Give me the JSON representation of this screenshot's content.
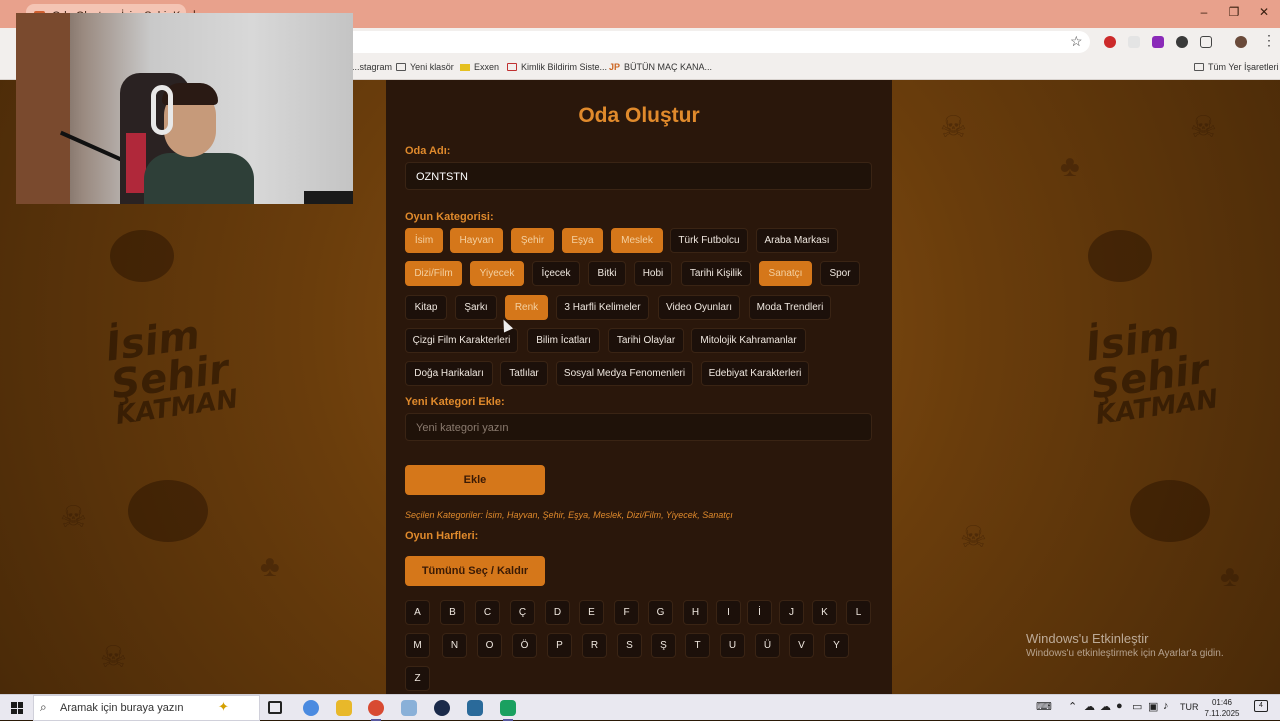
{
  "browser": {
    "tab_title": "Oda Oluştur - İsim Şehir Katman",
    "new_tab": "+",
    "bookmarks": [
      {
        "label": "...stagram",
        "icon": "instagram-icon"
      },
      {
        "label": "Yeni klasör",
        "icon": "folder-icon"
      },
      {
        "label": "Exxen",
        "icon": "exxen-icon"
      },
      {
        "label": "Kimlik Bildirim Siste...",
        "icon": "kimlik-icon"
      },
      {
        "label": "BÜTÜN MAÇ KANA...",
        "icon": "jp-icon"
      },
      {
        "label": "Tüm Yer İşaretleri",
        "icon": "folder-icon"
      }
    ],
    "bookmark_jp_prefix": "JP",
    "window_controls": {
      "minimize": "–",
      "restore": "❐",
      "close": "✕"
    }
  },
  "form": {
    "title": "Oda Oluştur",
    "room_name_label": "Oda Adı:",
    "room_name_value": "OZNTSTN",
    "category_label": "Oyun Kategorisi:",
    "categories": [
      {
        "label": "İsim",
        "selected": true
      },
      {
        "label": "Hayvan",
        "selected": true
      },
      {
        "label": "Şehir",
        "selected": true
      },
      {
        "label": "Eşya",
        "selected": true
      },
      {
        "label": "Meslek",
        "selected": true
      },
      {
        "label": "Türk Futbolcu",
        "selected": false
      },
      {
        "label": "Araba Markası",
        "selected": false
      },
      {
        "label": "Dizi/Film",
        "selected": true
      },
      {
        "label": "Yiyecek",
        "selected": true
      },
      {
        "label": "İçecek",
        "selected": false
      },
      {
        "label": "Bitki",
        "selected": false
      },
      {
        "label": "Hobi",
        "selected": false
      },
      {
        "label": "Tarihi Kişilik",
        "selected": false
      },
      {
        "label": "Sanatçı",
        "selected": true
      },
      {
        "label": "Spor",
        "selected": false
      },
      {
        "label": "Kitap",
        "selected": false
      },
      {
        "label": "Şarkı",
        "selected": false
      },
      {
        "label": "Renk",
        "selected": true
      },
      {
        "label": "3 Harfli Kelimeler",
        "selected": false
      },
      {
        "label": "Video Oyunları",
        "selected": false
      },
      {
        "label": "Moda Trendleri",
        "selected": false
      },
      {
        "label": "Çizgi Film Karakterleri",
        "selected": false
      },
      {
        "label": "Bilim İcatları",
        "selected": false
      },
      {
        "label": "Tarihi Olaylar",
        "selected": false
      },
      {
        "label": "Mitolojik Kahramanlar",
        "selected": false
      },
      {
        "label": "Doğa Harikaları",
        "selected": false
      },
      {
        "label": "Tatlılar",
        "selected": false
      },
      {
        "label": "Sosyal Medya Fenomenleri",
        "selected": false
      },
      {
        "label": "Edebiyat Karakterleri",
        "selected": false
      }
    ],
    "new_category_label": "Yeni Kategori Ekle:",
    "new_category_placeholder": "Yeni kategori yazın",
    "add_button": "Ekle",
    "selected_categories_text": "Seçilen Kategoriler: İsim, Hayvan, Şehir, Eşya, Meslek, Dizi/Film, Yiyecek, Sanatçı",
    "letters_label": "Oyun Harfleri:",
    "toggle_all_button": "Tümünü Seç / Kaldır",
    "letters": [
      "A",
      "B",
      "C",
      "Ç",
      "D",
      "E",
      "F",
      "G",
      "H",
      "I",
      "İ",
      "J",
      "K",
      "L",
      "M",
      "N",
      "O",
      "Ö",
      "P",
      "R",
      "S",
      "Ş",
      "T",
      "U",
      "Ü",
      "V",
      "Y",
      "Z"
    ]
  },
  "background_logo": {
    "line1": "İsim",
    "line2": "Şehir",
    "line3": "KATMAN"
  },
  "watermark": {
    "title": "Windows'u Etkinleştir",
    "subtitle": "Windows'u etkinleştirmek için Ayarlar'a gidin."
  },
  "taskbar": {
    "search_placeholder": "Aramak için buraya yazın",
    "language": "TUR",
    "time": "01:46",
    "date": "7.11.2025",
    "notification_count": "4"
  },
  "colors": {
    "accent": "#d5771a",
    "title": "#e08a2c",
    "panel": "#2a170b"
  }
}
